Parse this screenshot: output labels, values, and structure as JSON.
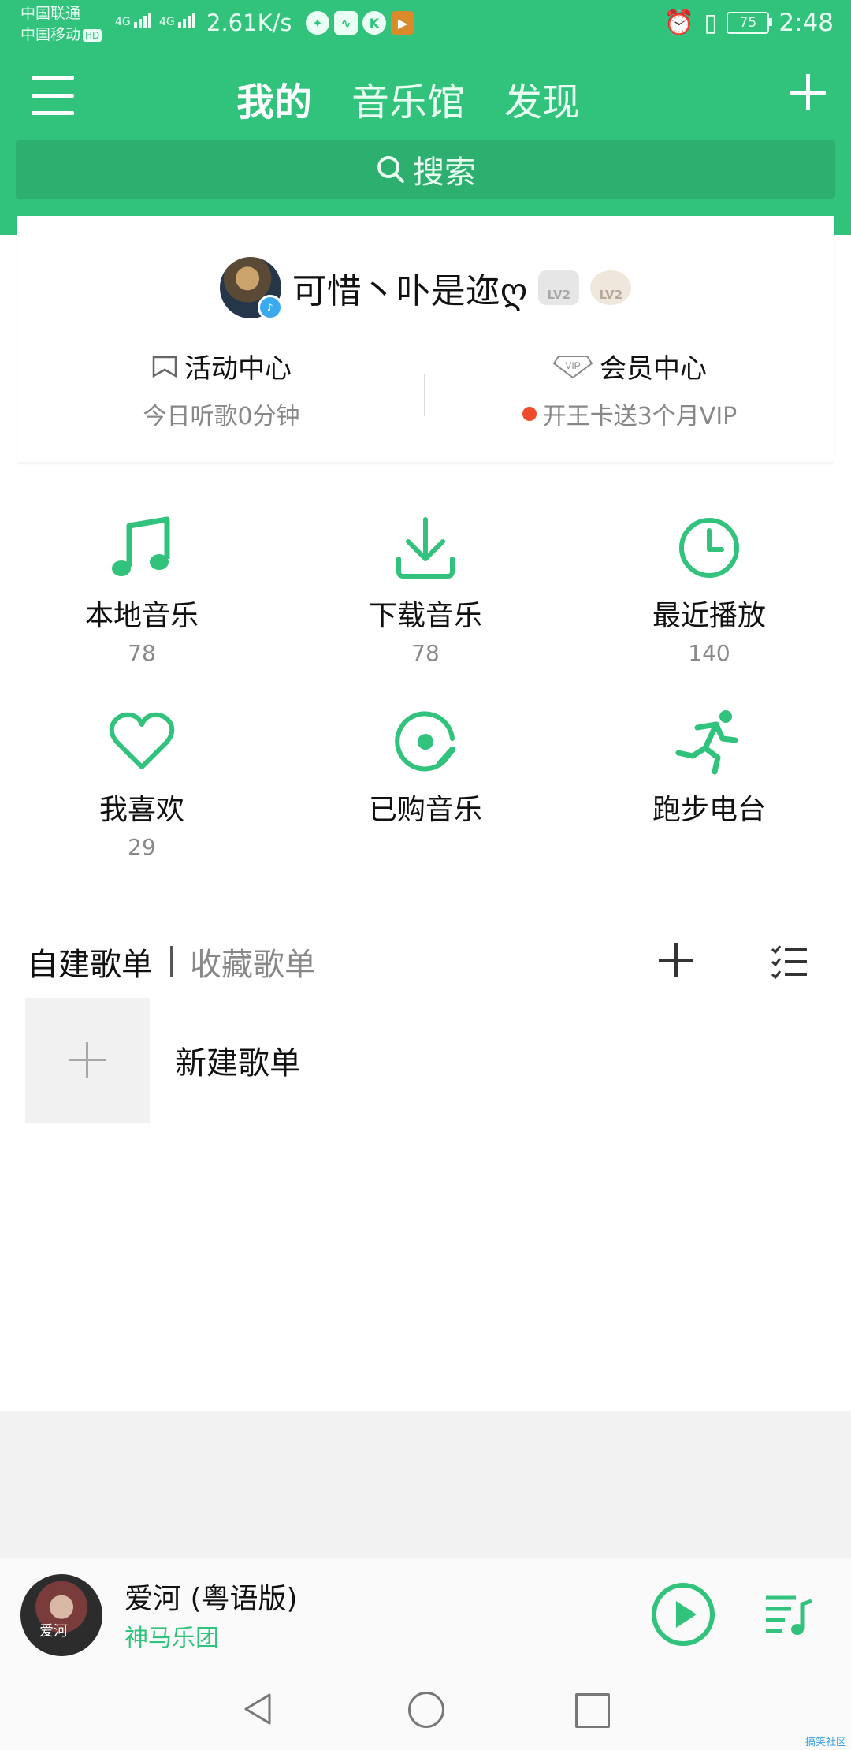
{
  "status": {
    "carrier1": "中国联通",
    "carrier2": "中国移动",
    "hd": "HD",
    "net1": "4G",
    "net2": "4G",
    "speed": "2.61K/s",
    "app_k": "K",
    "battery": "75",
    "time": "2:48"
  },
  "header": {
    "tabs": [
      "我的",
      "音乐馆",
      "发现"
    ],
    "active_tab": 0
  },
  "search": {
    "label": "搜索"
  },
  "profile": {
    "username": "可惜丶卟是迩ღ",
    "badge1": "LV2",
    "badge2": "LV2",
    "activity_title": "活动中心",
    "activity_sub": "今日听歌0分钟",
    "vip_title": "会员中心",
    "vip_icon_text": "VIP",
    "vip_sub": "开王卡送3个月VIP"
  },
  "grid": [
    {
      "label": "本地音乐",
      "count": "78",
      "icon": "music-note-icon"
    },
    {
      "label": "下载音乐",
      "count": "78",
      "icon": "download-icon"
    },
    {
      "label": "最近播放",
      "count": "140",
      "icon": "clock-icon"
    },
    {
      "label": "我喜欢",
      "count": "29",
      "icon": "heart-icon"
    },
    {
      "label": "已购音乐",
      "count": "",
      "icon": "disc-icon"
    },
    {
      "label": "跑步电台",
      "count": "",
      "icon": "running-icon"
    }
  ],
  "playlists": {
    "tab_own": "自建歌单",
    "tab_fav": "收藏歌单",
    "new_playlist": "新建歌单"
  },
  "player": {
    "title": "爱河 (粤语版)",
    "artist": "神马乐团",
    "cover_text": "爱河"
  },
  "watermark": "搞笑社区",
  "colors": {
    "brand": "#31c27c",
    "search_bg": "#2daf6f",
    "dot": "#f04b2c"
  }
}
